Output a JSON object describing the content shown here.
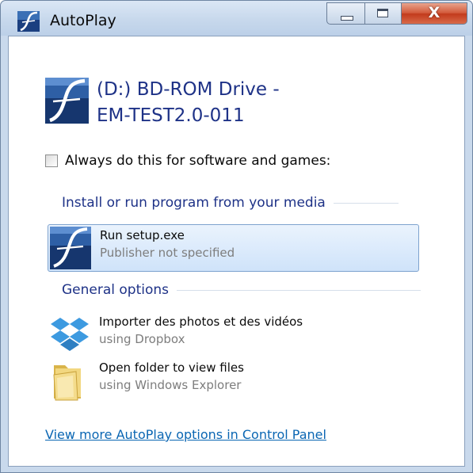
{
  "window": {
    "title": "AutoPlay",
    "close_glyph": "X",
    "icons": {
      "app": "autoplay-app-icon",
      "minimize": "minimize-icon",
      "maximize": "maximize-icon",
      "close": "close-icon"
    }
  },
  "drive": {
    "title_line1": "(D:) BD-ROM Drive -",
    "title_line2": "EM-TEST2.0-011",
    "icon": "setup-app-icon"
  },
  "always_checkbox": {
    "label": "Always do this for software and games:",
    "checked": false
  },
  "sections": {
    "install": "Install or run program from your media",
    "general": "General options"
  },
  "options": [
    {
      "title": "Run setup.exe",
      "subtitle": "Publisher not specified",
      "icon": "setup-app-icon",
      "selected": true
    },
    {
      "title": "Importer des photos et des vidéos",
      "subtitle": "using Dropbox",
      "icon": "dropbox-icon",
      "selected": false
    },
    {
      "title": "Open folder to view files",
      "subtitle": "using Windows Explorer",
      "icon": "folder-icon",
      "selected": false
    }
  ],
  "more_link": "View more AutoPlay options in Control Panel",
  "colors": {
    "heading_blue": "#1e3287",
    "link_blue": "#0a66b3",
    "selection_border": "#7da2ce",
    "close_red": "#c23a1c"
  }
}
